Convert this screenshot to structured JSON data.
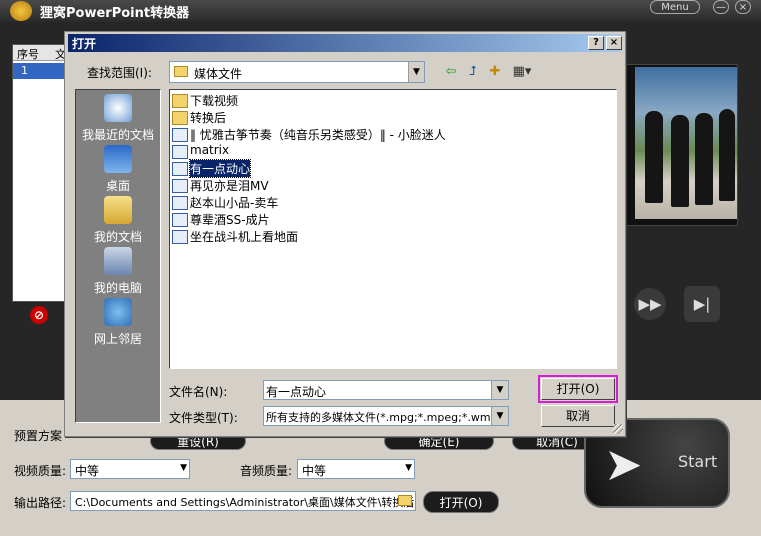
{
  "app": {
    "title": "狸窝PowerPoint转换器",
    "menu_label": "Menu",
    "minimize_label": "—",
    "close_label": "×",
    "list": {
      "col_no": "序号",
      "col_file": "文",
      "rows": [
        {
          "no": "1"
        }
      ]
    },
    "settings": {
      "preset_label": "预置方案",
      "video_quality_label": "视频质量:",
      "video_quality_value": "中等",
      "audio_quality_label": "音频质量:",
      "audio_quality_value": "中等",
      "output_path_label": "输出路径:",
      "output_path_value": "C:\\Documents and Settings\\Administrator\\桌面\\媒体文件\\转换后",
      "open_label": "打开(O)"
    },
    "start_label": "Start",
    "hidden_button_1": "重设(R)",
    "hidden_button_2": "确定(E)",
    "hidden_button_3": "取消(C)"
  },
  "dialog": {
    "title": "打开",
    "help_label": "?",
    "close_label": "×",
    "look_in_label": "查找范围(I):",
    "look_in_value": "媒体文件",
    "places": [
      {
        "label": "我最近的文档"
      },
      {
        "label": "桌面"
      },
      {
        "label": "我的文档"
      },
      {
        "label": "我的电脑"
      },
      {
        "label": "网上邻居"
      }
    ],
    "files": [
      {
        "name": "下载视频",
        "kind": "folder"
      },
      {
        "name": "转换后",
        "kind": "folder"
      },
      {
        "name": "‖ 忧雅古筝节奏（纯音乐另类感受）‖ - 小脸迷人",
        "kind": "media"
      },
      {
        "name": "matrix",
        "kind": "media"
      },
      {
        "name": "有一点动心",
        "kind": "media"
      },
      {
        "name": "再见亦是泪MV",
        "kind": "media"
      },
      {
        "name": "赵本山小品-卖车",
        "kind": "media"
      },
      {
        "name": "尊辈酒SS-成片",
        "kind": "media"
      },
      {
        "name": "坐在战斗机上看地面",
        "kind": "media"
      }
    ],
    "selected_file": "有一点动心",
    "file_name_label": "文件名(N):",
    "file_name_value": "有一点动心",
    "file_type_label": "文件类型(T):",
    "file_type_value": "所有支持的多媒体文件(*.mpg;*.mpeg;*.wm",
    "open_button": "打开(O)",
    "cancel_button": "取消"
  }
}
